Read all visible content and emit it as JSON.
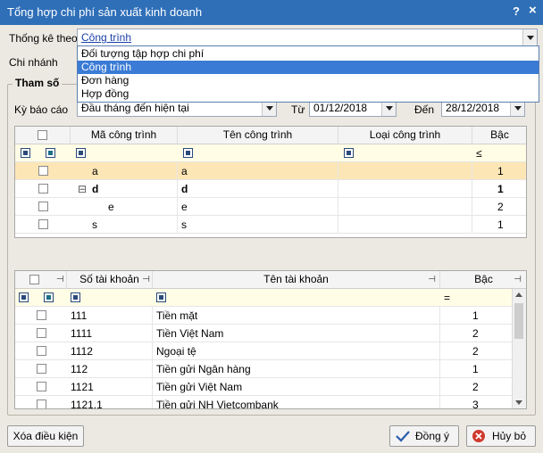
{
  "window": {
    "title": "Tổng hợp chi phí sản xuất kinh doanh",
    "help_label": "?",
    "close_label": "×"
  },
  "form": {
    "thong_ke_label": "Thống kê theo",
    "thong_ke_value": "Công trình",
    "chi_nhanh_label": "Chi nhánh",
    "dropdown_options": [
      "Đối tượng tập hợp chi phí",
      "Công trình",
      "Đơn hàng",
      "Hợp đồng"
    ],
    "dropdown_selected_index": 1,
    "tham_so_label": "Tham số",
    "ky_bao_cao_label": "Kỳ báo cáo",
    "ky_bao_cao_value": "Đầu tháng đến hiện tại",
    "tu_label": "Từ",
    "tu_value": "01/12/2018",
    "den_label": "Đến",
    "den_value": "28/12/2018"
  },
  "grid1": {
    "headers": [
      "Mã công trình",
      "Tên công trình",
      "Loại công trình",
      "Bậc"
    ],
    "filter_op": "≤",
    "rows": [
      {
        "ma": "a",
        "ten": "a",
        "loai": "",
        "bac": "1",
        "highlight": true,
        "bold": false,
        "expand": ""
      },
      {
        "ma": "d",
        "ten": "d",
        "loai": "",
        "bac": "1",
        "highlight": false,
        "bold": true,
        "expand": "⊟"
      },
      {
        "ma": "e",
        "ten": "e",
        "loai": "",
        "bac": "2",
        "highlight": false,
        "bold": false,
        "expand": ""
      },
      {
        "ma": "s",
        "ten": "s",
        "loai": "",
        "bac": "1",
        "highlight": false,
        "bold": false,
        "expand": ""
      }
    ]
  },
  "grid2": {
    "headers": [
      "Số tài khoản",
      "Tên tài khoản",
      "Bậc"
    ],
    "filter_op": "=",
    "rows": [
      {
        "so": "111",
        "ten": "Tiền mặt",
        "bac": "1"
      },
      {
        "so": "1111",
        "ten": "Tiền Việt Nam",
        "bac": "2"
      },
      {
        "so": "1112",
        "ten": "Ngoại tệ",
        "bac": "2"
      },
      {
        "so": "112",
        "ten": "Tiền gửi Ngân hàng",
        "bac": "1"
      },
      {
        "so": "1121",
        "ten": "Tiền gửi Việt Nam",
        "bac": "2"
      },
      {
        "so": "1121.1",
        "ten": "Tiền gửi NH Vietcombank",
        "bac": "3"
      }
    ]
  },
  "buttons": {
    "clear": "Xóa điều kiện",
    "ok": "Đồng ý",
    "cancel": "Hủy bỏ"
  },
  "colors": {
    "titlebar": "#2f6fb8",
    "selected": "#3a7bd5",
    "highlight_row": "#fde6b6",
    "filter_row": "#fffde6"
  }
}
